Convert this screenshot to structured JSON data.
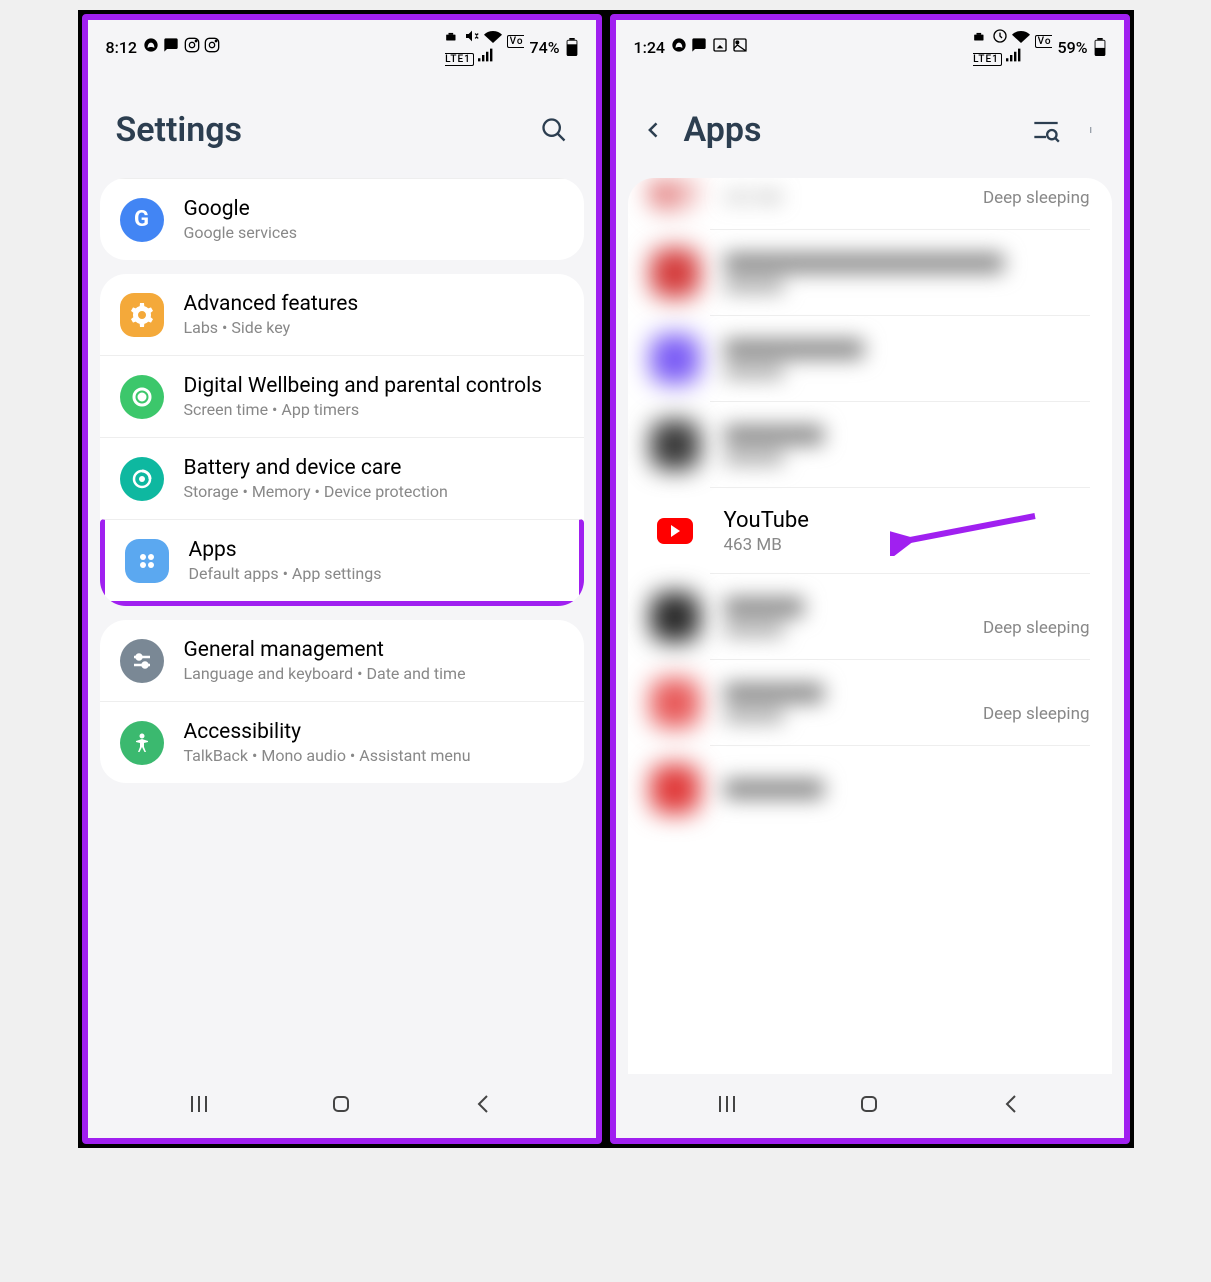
{
  "left": {
    "statusbar": {
      "time": "8:12",
      "battery": "74%"
    },
    "title": "Settings",
    "group1": [
      {
        "title": "Google",
        "subtitle": "Google services",
        "color": "#4285f4",
        "glyph": "G"
      }
    ],
    "group2": [
      {
        "title": "Advanced features",
        "subtitle": "Labs  •  Side key",
        "color": "#f4a93a",
        "glyph": "gear"
      },
      {
        "title": "Digital Wellbeing and parental controls",
        "subtitle": "Screen time  •  App timers",
        "color": "#3cc76b",
        "glyph": "circle"
      },
      {
        "title": "Battery and device care",
        "subtitle": "Storage  •  Memory  •  Device protection",
        "color": "#0eb8a0",
        "glyph": "refresh"
      },
      {
        "title": "Apps",
        "subtitle": "Default apps  •  App settings",
        "color": "#5ba8f0",
        "glyph": "dots",
        "highlight": true
      }
    ],
    "group3": [
      {
        "title": "General management",
        "subtitle": "Language and keyboard  •  Date and time",
        "color": "#7a8895",
        "glyph": "sliders"
      },
      {
        "title": "Accessibility",
        "subtitle": "TalkBack  •  Mono audio  •  Assistant menu",
        "color": "#3bb96f",
        "glyph": "person"
      }
    ]
  },
  "right": {
    "statusbar": {
      "time": "1:24",
      "battery": "59%"
    },
    "title": "Apps",
    "partial_top_size": "303 MB",
    "deep_sleeping": "Deep sleeping",
    "youtube": {
      "name": "YouTube",
      "size": "463 MB"
    },
    "blurred_apps": [
      {
        "icon_color": "#d43c3c"
      },
      {
        "icon_color": "#7b5cf5"
      },
      {
        "icon_color": "#3a3a3a"
      },
      {
        "icon_color": "#2a2a2a",
        "tag": true
      },
      {
        "icon_color": "#e85a5a",
        "tag": true
      },
      {
        "icon_color": "#e03a3a"
      }
    ]
  }
}
